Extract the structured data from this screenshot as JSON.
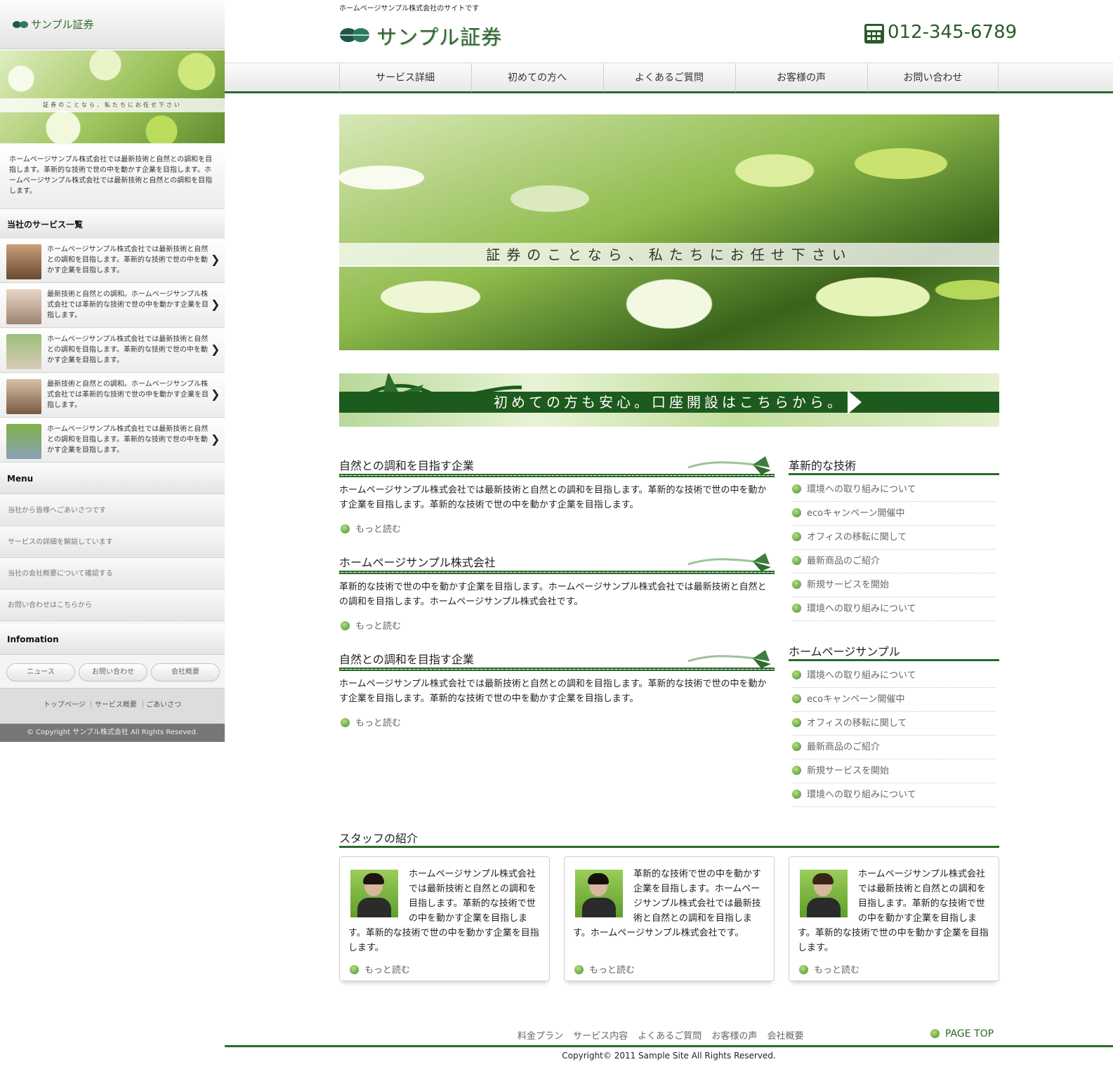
{
  "mobile": {
    "logo": "サンプル証券",
    "hero_caption": "証券のことなら、私たちにお任せ下さい",
    "intro": "ホームページサンプル株式会社では最新技術と自然との調和を目指します。革新的な技術で世の中を動かす企業を目指します。ホームページサンプル株式会社では最新技術と自然との調和を目指します。",
    "services_title": "当社のサービス一覧",
    "services": [
      "ホームページサンプル株式会社では最新技術と自然との調和を目指します。革新的な技術で世の中を動かす企業を目指します。",
      "最新技術と自然との調和。ホームページサンプル株式会社では革新的な技術で世の中を動かす企業を目指します。",
      "ホームページサンプル株式会社では最新技術と自然との調和を目指します。革新的な技術で世の中を動かす企業を目指します。",
      "最新技術と自然との調和。ホームページサンプル株式会社では革新的な技術で世の中を動かす企業を目指します。",
      "ホームページサンプル株式会社では最新技術と自然との調和を目指します。革新的な技術で世の中を動かす企業を目指します。"
    ],
    "menu_title": "Menu",
    "menu": [
      "当社から皆様へごあいさつです",
      "サービスの詳細を解説しています",
      "当社の会社概要について確認する",
      "お問い合わせはこちらから"
    ],
    "info_title": "Infomation",
    "pills": [
      "ニュース",
      "お問い合わせ",
      "会社概要"
    ],
    "links": "トップページ ｜サービス概要 ｜ごあいさつ",
    "copyright": "© Copyright サンプル株式会社 All Rights Reseved."
  },
  "header": {
    "tagline": "ホームページサンプル株式会社のサイトです",
    "logo": "サンプル証券",
    "phone": "012-345-6789"
  },
  "nav": [
    "サービス詳細",
    "初めての方へ",
    "よくあるご質問",
    "お客様の声",
    "お問い合わせ"
  ],
  "hero": {
    "caption": "証券のことなら、私たちにお任せ下さい"
  },
  "banner": {
    "text": "初めての方も安心。口座開設はこちらから。"
  },
  "articles": [
    {
      "title": "自然との調和を目指す企業",
      "body": "ホームページサンプル株式会社では最新技術と自然との調和を目指します。革新的な技術で世の中を動かす企業を目指します。革新的な技術で世の中を動かす企業を目指します。",
      "more": "もっと読む"
    },
    {
      "title": "ホームページサンプル株式会社",
      "body": "革新的な技術で世の中を動かす企業を目指します。ホームページサンプル株式会社では最新技術と自然との調和を目指します。ホームページサンプル株式会社です。",
      "more": "もっと読む"
    },
    {
      "title": "自然との調和を目指す企業",
      "body": "ホームページサンプル株式会社では最新技術と自然との調和を目指します。革新的な技術で世の中を動かす企業を目指します。革新的な技術で世の中を動かす企業を目指します。",
      "more": "もっと読む"
    }
  ],
  "sidebar": [
    {
      "title": "革新的な技術",
      "items": [
        "環境への取り組みについて",
        "ecoキャンペーン開催中",
        "オフィスの移転に関して",
        "最新商品のご紹介",
        "新規サービスを開始",
        "環境への取り組みについて"
      ]
    },
    {
      "title": "ホームページサンプル",
      "items": [
        "環境への取り組みについて",
        "ecoキャンペーン開催中",
        "オフィスの移転に関して",
        "最新商品のご紹介",
        "新規サービスを開始",
        "環境への取り組みについて"
      ]
    }
  ],
  "staff": {
    "title": "スタッフの紹介",
    "cards": [
      {
        "text": "ホームページサンプル株式会社では最新技術と自然との調和を目指します。革新的な技術で世の中を動かす企業を目指します。革新的な技術で世の中を動かす企業を目指します。",
        "more": "もっと読む"
      },
      {
        "text": "革新的な技術で世の中を動かす企業を目指します。ホームページサンプル株式会社では最新技術と自然との調和を目指します。ホームページサンプル株式会社です。",
        "more": "もっと読む"
      },
      {
        "text": "ホームページサンプル株式会社では最新技術と自然との調和を目指します。革新的な技術で世の中を動かす企業を目指します。革新的な技術で世の中を動かす企業を目指します。",
        "more": "もっと読む"
      }
    ]
  },
  "footer": {
    "links": "料金プラン サービス内容 よくあるご質問 お客様の声 会社概要",
    "pagetop": "PAGE TOP",
    "copyright": "Copyright© 2011 Sample Site All Rights Reserved."
  },
  "colors": {
    "accent": "#2b6b2b",
    "logo": "#2a6a2a"
  }
}
